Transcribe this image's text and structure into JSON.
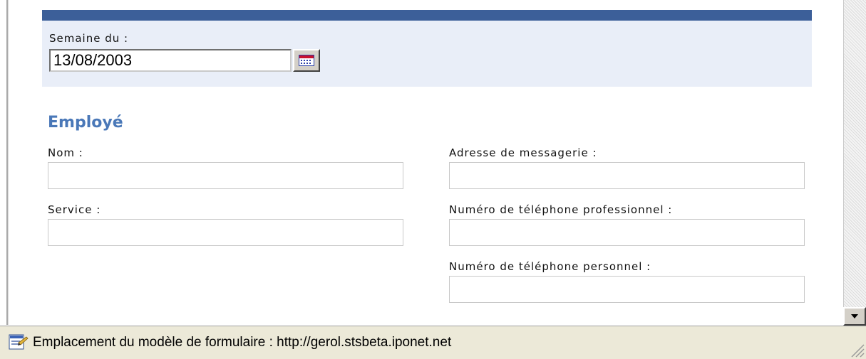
{
  "date_section": {
    "label": "Semaine du :",
    "value": "13/08/2003",
    "calendar_icon": "calendar-icon"
  },
  "employee": {
    "title": "Employé",
    "name_label": "Nom :",
    "service_label": "Service :",
    "email_label": "Adresse de messagerie :",
    "work_phone_label": "Numéro de téléphone professionnel :",
    "home_phone_label": "Numéro de téléphone personnel :",
    "name_value": "",
    "service_value": "",
    "email_value": "",
    "work_phone_value": "",
    "home_phone_value": ""
  },
  "status_bar": {
    "icon": "form-template-icon",
    "text": "Emplacement du modèle de formulaire : http://gerol.stsbeta.iponet.net"
  },
  "colors": {
    "header_bar": "#3c5f99",
    "section_bg": "#e9eef8",
    "title": "#4a78b8"
  }
}
